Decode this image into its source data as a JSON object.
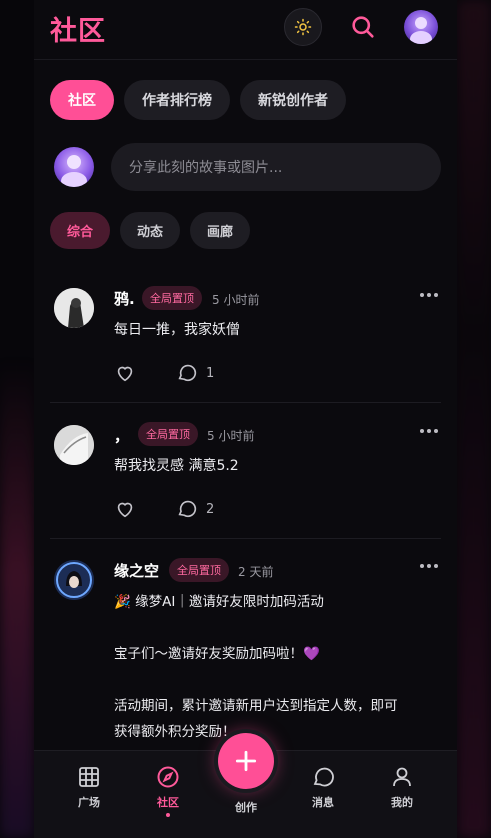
{
  "header": {
    "title": "社区",
    "theme_icon": "sun-icon",
    "search_icon": "search-icon"
  },
  "tabs": [
    {
      "label": "社区",
      "active": true
    },
    {
      "label": "作者排行榜",
      "active": false
    },
    {
      "label": "新锐创作者",
      "active": false
    }
  ],
  "composer": {
    "placeholder": "分享此刻的故事或图片..."
  },
  "subtabs": [
    {
      "label": "综合",
      "active": true
    },
    {
      "label": "动态",
      "active": false
    },
    {
      "label": "画廊",
      "active": false
    }
  ],
  "posts": [
    {
      "author": "鸦.",
      "badge": "全局置顶",
      "time": "5 小时前",
      "text": "每日一推，我家妖僧",
      "comments": "1"
    },
    {
      "author": "，",
      "badge": "全局置顶",
      "time": "5 小时前",
      "text": "帮我找灵感 满意5.2",
      "comments": "2"
    },
    {
      "author": "缘之空",
      "badge": "全局置顶",
      "time": "2 天前",
      "lines": [
        "🎉 缘梦AI｜邀请好友限时加码活动",
        "",
        "宝子们～邀请好友奖励加码啦！💜",
        "",
        "活动期间，累计邀请新用户达到指定人数，即可",
        "获得额外积分奖励！"
      ]
    }
  ],
  "nav": {
    "items": [
      {
        "label": "广场",
        "icon": "grid-icon",
        "active": false
      },
      {
        "label": "社区",
        "icon": "compass-icon",
        "active": true
      },
      {
        "label": "创作",
        "icon": "plus-icon",
        "active": false
      },
      {
        "label": "消息",
        "icon": "chat-icon",
        "active": false
      },
      {
        "label": "我的",
        "icon": "user-icon",
        "active": false
      }
    ]
  },
  "colors": {
    "accent": "#ff4f96",
    "background": "#0b0a0e"
  }
}
